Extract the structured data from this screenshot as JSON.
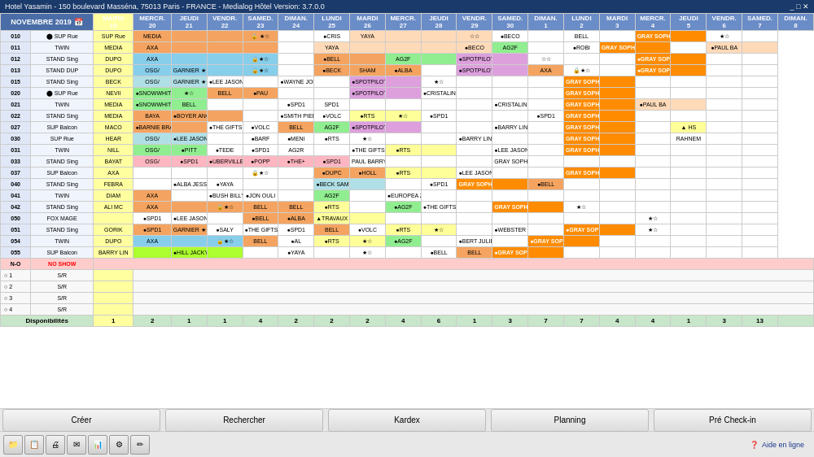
{
  "titlebar": {
    "title": "Hotel Yasamin - 150 boulevard Masséna, 75013 Paris - FRANCE - Medialog Hôtel Version: 3.7.0.0"
  },
  "header": {
    "month": "NOVEMBRE 2019",
    "days": [
      "MARDI 19",
      "MERCR. 20",
      "JEUDI 21",
      "VENDR. 22",
      "SAMED. 23",
      "DIMAN. 24",
      "LUNDI 25",
      "MARDI 26",
      "MERCR. 27",
      "JEUDI 28",
      "VENDR. 29",
      "SAMED. 30",
      "DIMAN. 1",
      "LUNDI 2",
      "MARDI 3",
      "MERCR. 4",
      "JEUDI 5",
      "VENDR. 6",
      "SAMED. 7",
      "DIMAN. 8"
    ]
  },
  "toolbar": {
    "creer": "Créer",
    "rechercher": "Rechercher",
    "kardex": "Kardex",
    "planning": "Planning",
    "pre_checkin": "Pré Check-in"
  },
  "statusbar": {
    "aide": "Aide en ligne"
  },
  "rooms": [
    {
      "num": "010",
      "type": "SUP Rue"
    },
    {
      "num": "011",
      "type": "TWIN"
    },
    {
      "num": "012",
      "type": "STAND Sing"
    },
    {
      "num": "013",
      "type": "STAND DUP"
    },
    {
      "num": "015",
      "type": "STAND Sing"
    },
    {
      "num": "020",
      "type": "SUP Rue"
    },
    {
      "num": "021",
      "type": "TWIN"
    },
    {
      "num": "022",
      "type": "STAND Sing"
    },
    {
      "num": "027",
      "type": "SUP Balcon"
    },
    {
      "num": "030",
      "type": "SUP Rue"
    },
    {
      "num": "031",
      "type": "TWIN"
    },
    {
      "num": "033",
      "type": "STAND Sing"
    },
    {
      "num": "037",
      "type": "SUP Balcon"
    },
    {
      "num": "040",
      "type": "STAND Sing"
    },
    {
      "num": "041",
      "type": "TWIN"
    },
    {
      "num": "042",
      "type": "STAND Sing"
    },
    {
      "num": "050",
      "type": ""
    },
    {
      "num": "051",
      "type": "STAND Sing"
    },
    {
      "num": "054",
      "type": "TWIN"
    },
    {
      "num": "055",
      "type": "SUP Balcon"
    },
    {
      "num": "N-O",
      "type": "NO SHOW"
    }
  ]
}
